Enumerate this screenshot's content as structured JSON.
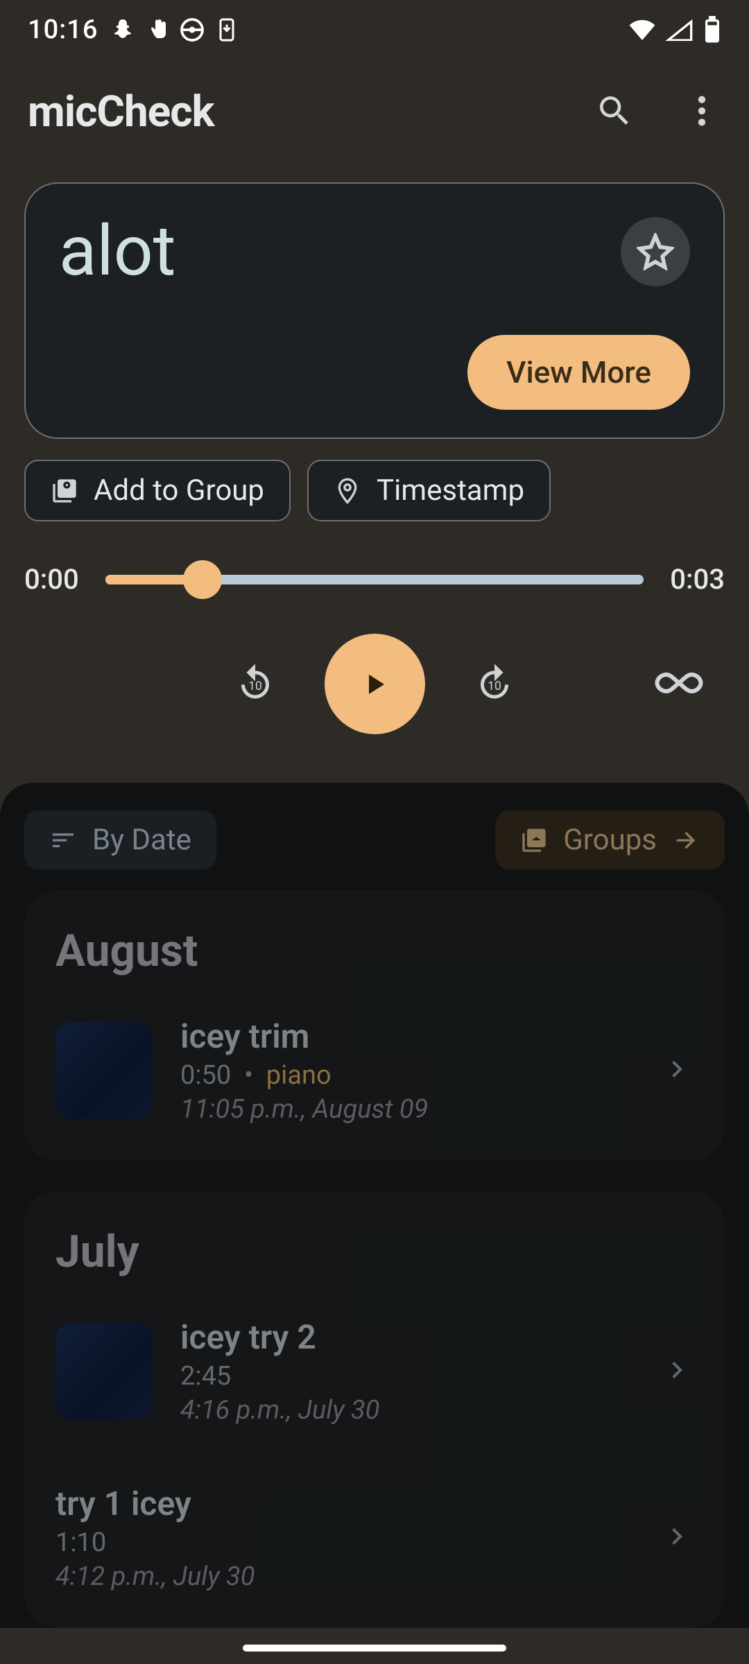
{
  "status": {
    "time": "10:16"
  },
  "app": {
    "title": "micCheck"
  },
  "nowPlaying": {
    "title": "alot",
    "viewMore": "View More"
  },
  "chips": {
    "addToGroup": "Add to Group",
    "timestamp": "Timestamp"
  },
  "progress": {
    "current": "0:00",
    "total": "0:03"
  },
  "panel": {
    "sort": "By Date",
    "groups": "Groups"
  },
  "months": [
    {
      "name": "August",
      "recs": [
        {
          "title": "icey trim",
          "length": "0:50",
          "tag": "piano",
          "date": "11:05 p.m., August 09",
          "hasThumb": true
        }
      ]
    },
    {
      "name": "July",
      "recs": [
        {
          "title": "icey try 2",
          "length": "2:45",
          "tag": "",
          "date": "4:16 p.m., July 30",
          "hasThumb": true
        },
        {
          "title": "try 1 icey",
          "length": "1:10",
          "tag": "",
          "date": "4:12 p.m., July 30",
          "hasThumb": false
        }
      ]
    }
  ]
}
